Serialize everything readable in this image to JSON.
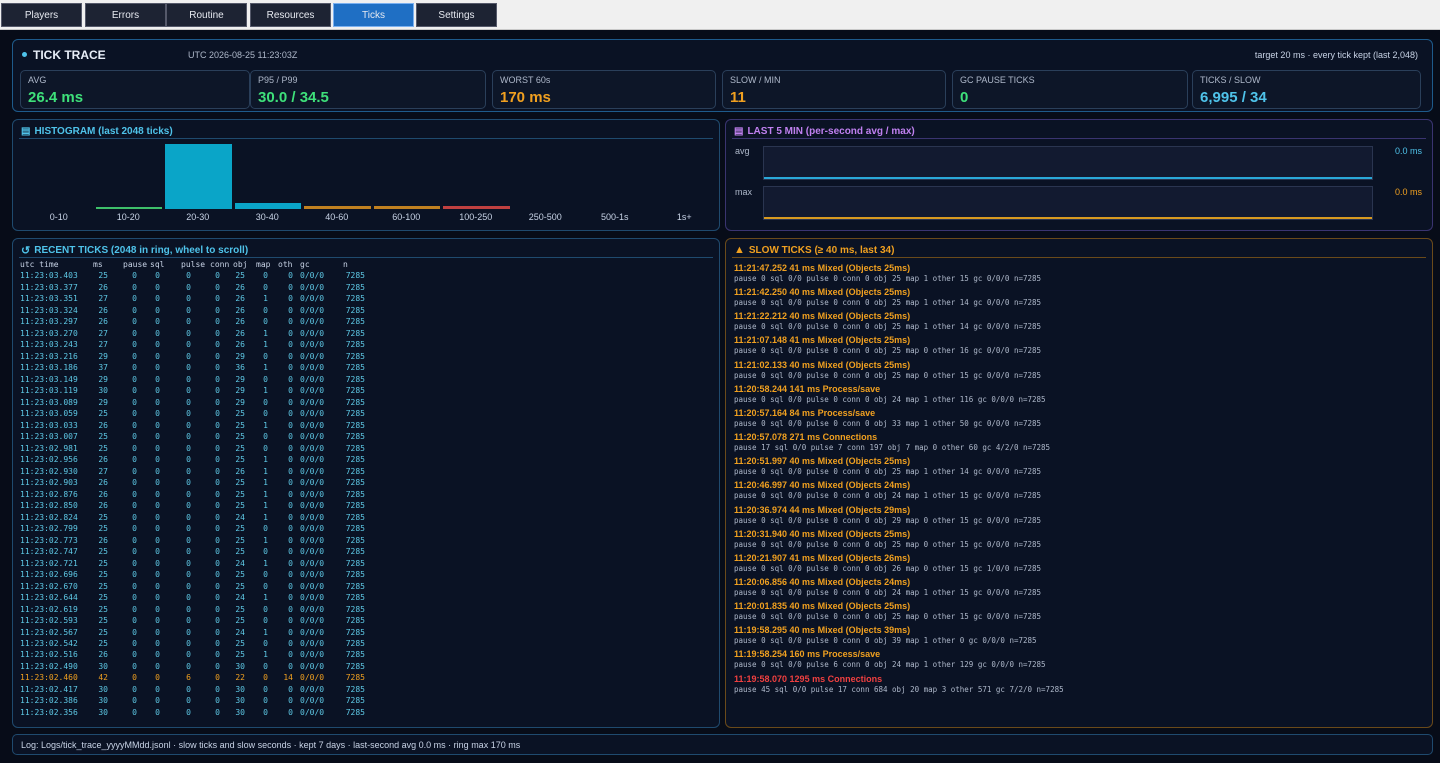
{
  "tabs": [
    {
      "label": "Players",
      "active": false
    },
    {
      "label": "Errors",
      "active": false
    },
    {
      "label": "Routine",
      "active": false
    },
    {
      "label": "Resources",
      "active": false
    },
    {
      "label": "Ticks",
      "active": true
    },
    {
      "label": "Settings",
      "active": false
    }
  ],
  "trace": {
    "title": "TICK TRACE",
    "timestamp": "UTC 2026-08-25 11:23:03Z",
    "target": "target 20 ms · every tick kept (last 2,048)"
  },
  "stats": [
    {
      "label": "AVG",
      "value": "26.4 ms",
      "color": "#3ee07a"
    },
    {
      "label": "P95 / P99",
      "value": "30.0 / 34.5",
      "color": "#3ee07a"
    },
    {
      "label": "WORST 60s",
      "value": "170 ms",
      "color": "#f0a020"
    },
    {
      "label": "SLOW / MIN",
      "value": "11",
      "color": "#f0a020"
    },
    {
      "label": "GC PAUSE TICKS",
      "value": "0",
      "color": "#3ee07a"
    },
    {
      "label": "TICKS / SLOW",
      "value": "6,995 / 34",
      "color": "#4fc3ea"
    }
  ],
  "histogram": {
    "title": "HISTOGRAM (last 2048 ticks)",
    "bins": [
      {
        "label": "0-10",
        "value": 0,
        "color": "#3ee07a"
      },
      {
        "label": "10-20",
        "value": 0.4,
        "color": "#3ec06a"
      },
      {
        "label": "20-30",
        "value": 100,
        "color": "#0aa5c8"
      },
      {
        "label": "30-40",
        "value": 10,
        "color": "#0aa5c8"
      },
      {
        "label": "40-60",
        "value": 4,
        "color": "#c08020"
      },
      {
        "label": "60-100",
        "value": 4,
        "color": "#c08020"
      },
      {
        "label": "100-250",
        "value": 4,
        "color": "#c04040"
      },
      {
        "label": "250-500",
        "value": 0,
        "color": "#c04040"
      },
      {
        "label": "500-1s",
        "value": 0,
        "color": "#c04040"
      },
      {
        "label": "1s+",
        "value": 0,
        "color": "#c04040"
      }
    ]
  },
  "last5": {
    "title": "LAST 5 MIN (per-second avg / max)",
    "avg_label": "avg",
    "avg_value": "0.0 ms",
    "max_label": "max",
    "max_value": "0.0 ms"
  },
  "recent": {
    "title": "RECENT TICKS  (2048 in ring, wheel to scroll)",
    "headers": [
      "utc time",
      "ms",
      "pause",
      "sql",
      "pulse",
      "conn",
      "obj",
      "map",
      "oth",
      "gc",
      "n"
    ],
    "rows": [
      [
        "11:23:03.403",
        "25",
        "0",
        "0",
        "0",
        "0",
        "25",
        "0",
        "0",
        "0/0/0",
        "7285"
      ],
      [
        "11:23:03.377",
        "26",
        "0",
        "0",
        "0",
        "0",
        "26",
        "0",
        "0",
        "0/0/0",
        "7285"
      ],
      [
        "11:23:03.351",
        "27",
        "0",
        "0",
        "0",
        "0",
        "26",
        "1",
        "0",
        "0/0/0",
        "7285"
      ],
      [
        "11:23:03.324",
        "26",
        "0",
        "0",
        "0",
        "0",
        "26",
        "0",
        "0",
        "0/0/0",
        "7285"
      ],
      [
        "11:23:03.297",
        "26",
        "0",
        "0",
        "0",
        "0",
        "26",
        "0",
        "0",
        "0/0/0",
        "7285"
      ],
      [
        "11:23:03.270",
        "27",
        "0",
        "0",
        "0",
        "0",
        "26",
        "1",
        "0",
        "0/0/0",
        "7285"
      ],
      [
        "11:23:03.243",
        "27",
        "0",
        "0",
        "0",
        "0",
        "26",
        "1",
        "0",
        "0/0/0",
        "7285"
      ],
      [
        "11:23:03.216",
        "29",
        "0",
        "0",
        "0",
        "0",
        "29",
        "0",
        "0",
        "0/0/0",
        "7285"
      ],
      [
        "11:23:03.186",
        "37",
        "0",
        "0",
        "0",
        "0",
        "36",
        "1",
        "0",
        "0/0/0",
        "7285"
      ],
      [
        "11:23:03.149",
        "29",
        "0",
        "0",
        "0",
        "0",
        "29",
        "0",
        "0",
        "0/0/0",
        "7285"
      ],
      [
        "11:23:03.119",
        "30",
        "0",
        "0",
        "0",
        "0",
        "29",
        "1",
        "0",
        "0/0/0",
        "7285"
      ],
      [
        "11:23:03.089",
        "29",
        "0",
        "0",
        "0",
        "0",
        "29",
        "0",
        "0",
        "0/0/0",
        "7285"
      ],
      [
        "11:23:03.059",
        "25",
        "0",
        "0",
        "0",
        "0",
        "25",
        "0",
        "0",
        "0/0/0",
        "7285"
      ],
      [
        "11:23:03.033",
        "26",
        "0",
        "0",
        "0",
        "0",
        "25",
        "1",
        "0",
        "0/0/0",
        "7285"
      ],
      [
        "11:23:03.007",
        "25",
        "0",
        "0",
        "0",
        "0",
        "25",
        "0",
        "0",
        "0/0/0",
        "7285"
      ],
      [
        "11:23:02.981",
        "25",
        "0",
        "0",
        "0",
        "0",
        "25",
        "0",
        "0",
        "0/0/0",
        "7285"
      ],
      [
        "11:23:02.956",
        "26",
        "0",
        "0",
        "0",
        "0",
        "25",
        "1",
        "0",
        "0/0/0",
        "7285"
      ],
      [
        "11:23:02.930",
        "27",
        "0",
        "0",
        "0",
        "0",
        "26",
        "1",
        "0",
        "0/0/0",
        "7285"
      ],
      [
        "11:23:02.903",
        "26",
        "0",
        "0",
        "0",
        "0",
        "25",
        "1",
        "0",
        "0/0/0",
        "7285"
      ],
      [
        "11:23:02.876",
        "26",
        "0",
        "0",
        "0",
        "0",
        "25",
        "1",
        "0",
        "0/0/0",
        "7285"
      ],
      [
        "11:23:02.850",
        "26",
        "0",
        "0",
        "0",
        "0",
        "25",
        "1",
        "0",
        "0/0/0",
        "7285"
      ],
      [
        "11:23:02.824",
        "25",
        "0",
        "0",
        "0",
        "0",
        "24",
        "1",
        "0",
        "0/0/0",
        "7285"
      ],
      [
        "11:23:02.799",
        "25",
        "0",
        "0",
        "0",
        "0",
        "25",
        "0",
        "0",
        "0/0/0",
        "7285"
      ],
      [
        "11:23:02.773",
        "26",
        "0",
        "0",
        "0",
        "0",
        "25",
        "1",
        "0",
        "0/0/0",
        "7285"
      ],
      [
        "11:23:02.747",
        "25",
        "0",
        "0",
        "0",
        "0",
        "25",
        "0",
        "0",
        "0/0/0",
        "7285"
      ],
      [
        "11:23:02.721",
        "25",
        "0",
        "0",
        "0",
        "0",
        "24",
        "1",
        "0",
        "0/0/0",
        "7285"
      ],
      [
        "11:23:02.696",
        "25",
        "0",
        "0",
        "0",
        "0",
        "25",
        "0",
        "0",
        "0/0/0",
        "7285"
      ],
      [
        "11:23:02.670",
        "25",
        "0",
        "0",
        "0",
        "0",
        "25",
        "0",
        "0",
        "0/0/0",
        "7285"
      ],
      [
        "11:23:02.644",
        "25",
        "0",
        "0",
        "0",
        "0",
        "24",
        "1",
        "0",
        "0/0/0",
        "7285"
      ],
      [
        "11:23:02.619",
        "25",
        "0",
        "0",
        "0",
        "0",
        "25",
        "0",
        "0",
        "0/0/0",
        "7285"
      ],
      [
        "11:23:02.593",
        "25",
        "0",
        "0",
        "0",
        "0",
        "25",
        "0",
        "0",
        "0/0/0",
        "7285"
      ],
      [
        "11:23:02.567",
        "25",
        "0",
        "0",
        "0",
        "0",
        "24",
        "1",
        "0",
        "0/0/0",
        "7285"
      ],
      [
        "11:23:02.542",
        "25",
        "0",
        "0",
        "0",
        "0",
        "25",
        "0",
        "0",
        "0/0/0",
        "7285"
      ],
      [
        "11:23:02.516",
        "26",
        "0",
        "0",
        "0",
        "0",
        "25",
        "1",
        "0",
        "0/0/0",
        "7285"
      ],
      [
        "11:23:02.490",
        "30",
        "0",
        "0",
        "0",
        "0",
        "30",
        "0",
        "0",
        "0/0/0",
        "7285"
      ],
      [
        "11:23:02.460",
        "42",
        "0",
        "0",
        "6",
        "0",
        "22",
        "0",
        "14",
        "0/0/0",
        "7285"
      ],
      [
        "11:23:02.417",
        "30",
        "0",
        "0",
        "0",
        "0",
        "30",
        "0",
        "0",
        "0/0/0",
        "7285"
      ],
      [
        "11:23:02.386",
        "30",
        "0",
        "0",
        "0",
        "0",
        "30",
        "0",
        "0",
        "0/0/0",
        "7285"
      ],
      [
        "11:23:02.356",
        "30",
        "0",
        "0",
        "0",
        "0",
        "30",
        "0",
        "0",
        "0/0/0",
        "7285"
      ]
    ],
    "highlight_row": 35,
    "normal_color": "#5ec9e6",
    "highlight_color": "#f0a020"
  },
  "slow": {
    "title": "SLOW TICKS  (≥ 40 ms, last 34)",
    "items": [
      {
        "title": "11:21:47.252  41 ms  Mixed (Objects 25ms)",
        "detail": "pause 0  sql 0/0  pulse 0  conn 0  obj 25  map 1  other 15  gc 0/0/0  n=7285",
        "color": "#f0a020"
      },
      {
        "title": "11:21:42.250  40 ms  Mixed (Objects 25ms)",
        "detail": "pause 0  sql 0/0  pulse 0  conn 0  obj 25  map 1  other 14  gc 0/0/0  n=7285",
        "color": "#f0a020"
      },
      {
        "title": "11:21:22.212  40 ms  Mixed (Objects 25ms)",
        "detail": "pause 0  sql 0/0  pulse 0  conn 0  obj 25  map 1  other 14  gc 0/0/0  n=7285",
        "color": "#f0a020"
      },
      {
        "title": "11:21:07.148  41 ms  Mixed (Objects 25ms)",
        "detail": "pause 0  sql 0/0  pulse 0  conn 0  obj 25  map 0  other 16  gc 0/0/0  n=7285",
        "color": "#f0a020"
      },
      {
        "title": "11:21:02.133  40 ms  Mixed (Objects 25ms)",
        "detail": "pause 0  sql 0/0  pulse 0  conn 0  obj 25  map 0  other 15  gc 0/0/0  n=7285",
        "color": "#f0a020"
      },
      {
        "title": "11:20:58.244  141 ms  Process/save",
        "detail": "pause 0  sql 0/0  pulse 0  conn 0  obj 24  map 1  other 116  gc 0/0/0  n=7285",
        "color": "#f0a020"
      },
      {
        "title": "11:20:57.164  84 ms  Process/save",
        "detail": "pause 0  sql 0/0  pulse 0  conn 0  obj 33  map 1  other 50  gc 0/0/0  n=7285",
        "color": "#f0a020"
      },
      {
        "title": "11:20:57.078  271 ms  Connections",
        "detail": "pause 17  sql 0/0  pulse 7  conn 197  obj 7  map 0  other 60  gc 4/2/0  n=7285",
        "color": "#f0a020"
      },
      {
        "title": "11:20:51.997  40 ms  Mixed (Objects 25ms)",
        "detail": "pause 0  sql 0/0  pulse 0  conn 0  obj 25  map 1  other 14  gc 0/0/0  n=7285",
        "color": "#f0a020"
      },
      {
        "title": "11:20:46.997  40 ms  Mixed (Objects 24ms)",
        "detail": "pause 0  sql 0/0  pulse 0  conn 0  obj 24  map 1  other 15  gc 0/0/0  n=7285",
        "color": "#f0a020"
      },
      {
        "title": "11:20:36.974  44 ms  Mixed (Objects 29ms)",
        "detail": "pause 0  sql 0/0  pulse 0  conn 0  obj 29  map 0  other 15  gc 0/0/0  n=7285",
        "color": "#f0a020"
      },
      {
        "title": "11:20:31.940  40 ms  Mixed (Objects 25ms)",
        "detail": "pause 0  sql 0/0  pulse 0  conn 0  obj 25  map 0  other 15  gc 0/0/0  n=7285",
        "color": "#f0a020"
      },
      {
        "title": "11:20:21.907  41 ms  Mixed (Objects 26ms)",
        "detail": "pause 0  sql 0/0  pulse 0  conn 0  obj 26  map 0  other 15  gc 1/0/0  n=7285",
        "color": "#f0a020"
      },
      {
        "title": "11:20:06.856  40 ms  Mixed (Objects 24ms)",
        "detail": "pause 0  sql 0/0  pulse 0  conn 0  obj 24  map 1  other 15  gc 0/0/0  n=7285",
        "color": "#f0a020"
      },
      {
        "title": "11:20:01.835  40 ms  Mixed (Objects 25ms)",
        "detail": "pause 0  sql 0/0  pulse 0  conn 0  obj 25  map 0  other 15  gc 0/0/0  n=7285",
        "color": "#f0a020"
      },
      {
        "title": "11:19:58.295  40 ms  Mixed (Objects 39ms)",
        "detail": "pause 0  sql 0/0  pulse 0  conn 0  obj 39  map 1  other 0  gc 0/0/0  n=7285",
        "color": "#f0a020"
      },
      {
        "title": "11:19:58.254  160 ms  Process/save",
        "detail": "pause 0  sql 0/0  pulse 6  conn 0  obj 24  map 1  other 129  gc 0/0/0  n=7285",
        "color": "#f0a020"
      },
      {
        "title": "11:19:58.070  1295 ms  Connections",
        "detail": "pause 45  sql 0/0  pulse 17  conn 684  obj 20  map 3  other 571  gc 7/2/0  n=7285",
        "color": "#f04040"
      }
    ]
  },
  "footer": "Log: Logs/tick_trace_yyyyMMdd.jsonl  ·  slow ticks and slow seconds  ·  kept 7 days  ·  last-second avg 0.0 ms  ·  ring max 170 ms"
}
